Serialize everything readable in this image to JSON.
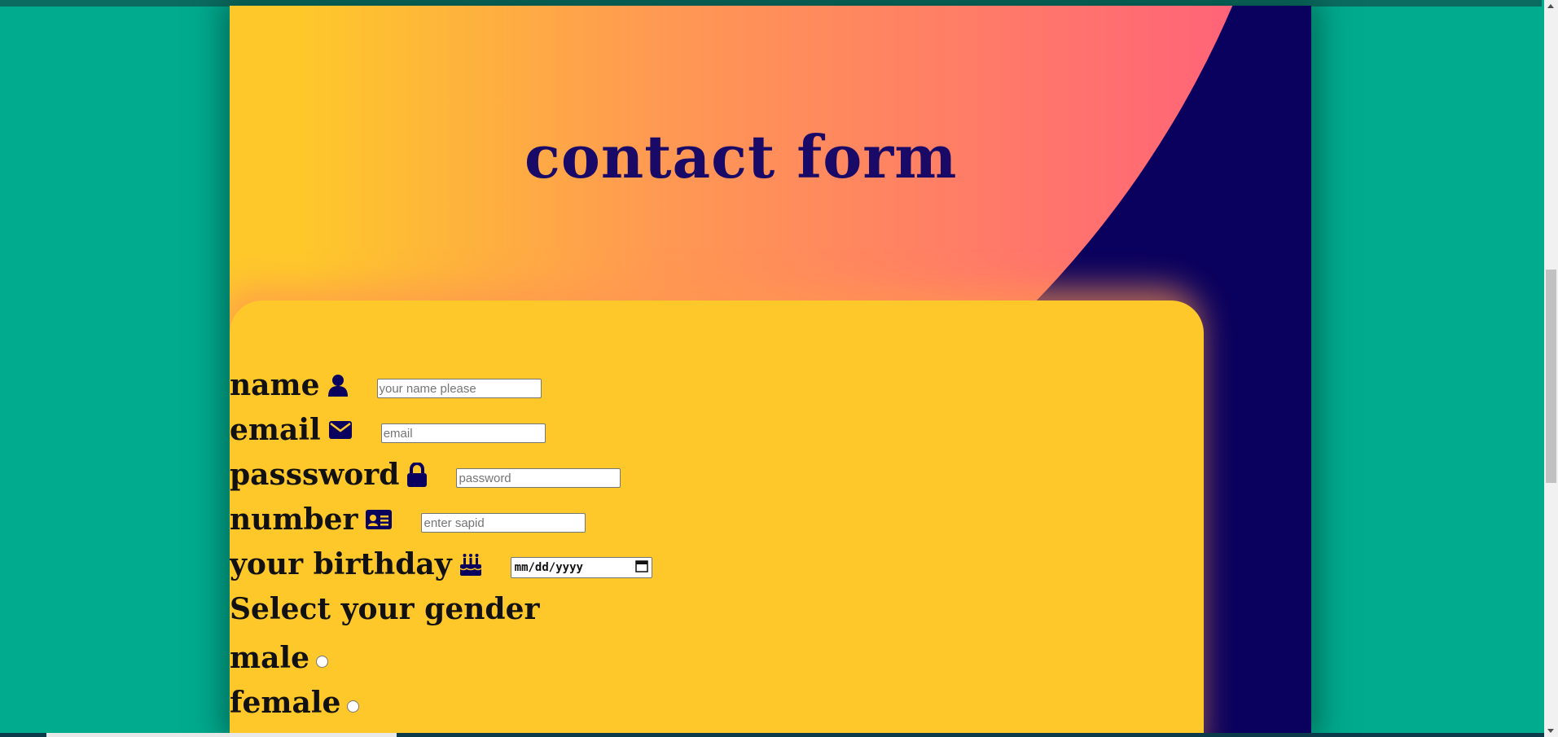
{
  "page": {
    "title": "contact form"
  },
  "form": {
    "name": {
      "label": "name",
      "icon": "user-icon",
      "placeholder": "your name please"
    },
    "email": {
      "label": "email",
      "icon": "envelope-icon",
      "placeholder": "email"
    },
    "password": {
      "label": "passsword",
      "icon": "lock-icon",
      "placeholder": "password"
    },
    "number": {
      "label": "number",
      "icon": "id-card-icon",
      "placeholder": "enter sapid"
    },
    "birthday": {
      "label": "your birthday",
      "icon": "birthday-cake-icon",
      "value": "mm/dd/yyyy"
    },
    "gender": {
      "label": "Select your gender",
      "options": [
        {
          "label": "male"
        },
        {
          "label": "female"
        }
      ]
    }
  },
  "colors": {
    "background": "#00ab8e",
    "card_dark": "#0a005e",
    "panel_yellow": "#fec82b",
    "gradient_pink": "#ff5c7d",
    "title_color": "#180a66"
  }
}
